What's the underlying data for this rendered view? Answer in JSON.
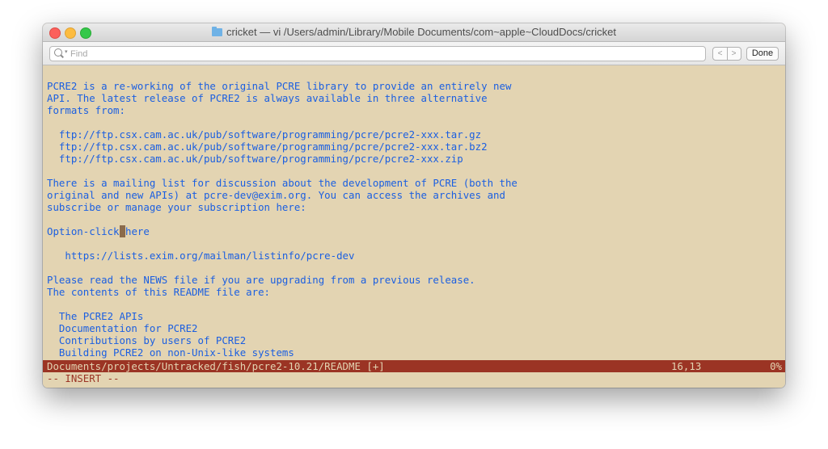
{
  "window": {
    "title": "cricket — vi  /Users/admin/Library/Mobile Documents/com~apple~CloudDocs/cricket"
  },
  "find_bar": {
    "placeholder": "Find",
    "prev_label": "<",
    "next_label": ">",
    "done_label": "Done"
  },
  "editor": {
    "lines": [
      "PCRE2 is a re-working of the original PCRE library to provide an entirely new",
      "API. The latest release of PCRE2 is always available in three alternative",
      "formats from:",
      "",
      "  ftp://ftp.csx.cam.ac.uk/pub/software/programming/pcre/pcre2-xxx.tar.gz",
      "  ftp://ftp.csx.cam.ac.uk/pub/software/programming/pcre/pcre2-xxx.tar.bz2",
      "  ftp://ftp.csx.cam.ac.uk/pub/software/programming/pcre/pcre2-xxx.zip",
      "",
      "There is a mailing list for discussion about the development of PCRE (both the",
      "original and new APIs) at pcre-dev@exim.org. You can access the archives and",
      "subscribe or manage your subscription here:",
      "",
      "",
      "",
      "   https://lists.exim.org/mailman/listinfo/pcre-dev",
      "",
      "Please read the NEWS file if you are upgrading from a previous release.",
      "The contents of this README file are:",
      "",
      "  The PCRE2 APIs",
      "  Documentation for PCRE2",
      "  Contributions by users of PCRE2",
      "  Building PCRE2 on non-Unix-like systems"
    ],
    "cursor_line": {
      "before": "Option-click",
      "under": " ",
      "after": "here"
    },
    "status": {
      "file": "Documents/projects/Untracked/fish/pcre2-10.21/README [+]",
      "position": "16,13",
      "percent": "0%"
    },
    "mode": "-- INSERT --"
  },
  "colors": {
    "background": "#e3d4b2",
    "text": "#1b5fe1",
    "statusline": "#9b3424"
  },
  "icons": [
    "folder-icon",
    "search-icon"
  ]
}
